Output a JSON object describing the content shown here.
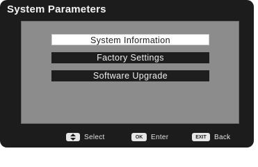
{
  "header": {
    "title": "System Parameters"
  },
  "menu": {
    "items": [
      {
        "label": "System Information",
        "selected": true
      },
      {
        "label": "Factory Settings",
        "selected": false
      },
      {
        "label": "Software Upgrade",
        "selected": false
      }
    ]
  },
  "footer": {
    "hints": [
      {
        "key_icon": "up-down-arrows-icon",
        "label": "Select"
      },
      {
        "key_text": "OK",
        "label": "Enter"
      },
      {
        "key_text": "EXIT",
        "label": "Back"
      }
    ]
  },
  "colors": {
    "background": "#1c1c1c",
    "panel": "#8c8c8c",
    "selected_item": "#ffffff",
    "normal_item": "#1e1e1e"
  }
}
